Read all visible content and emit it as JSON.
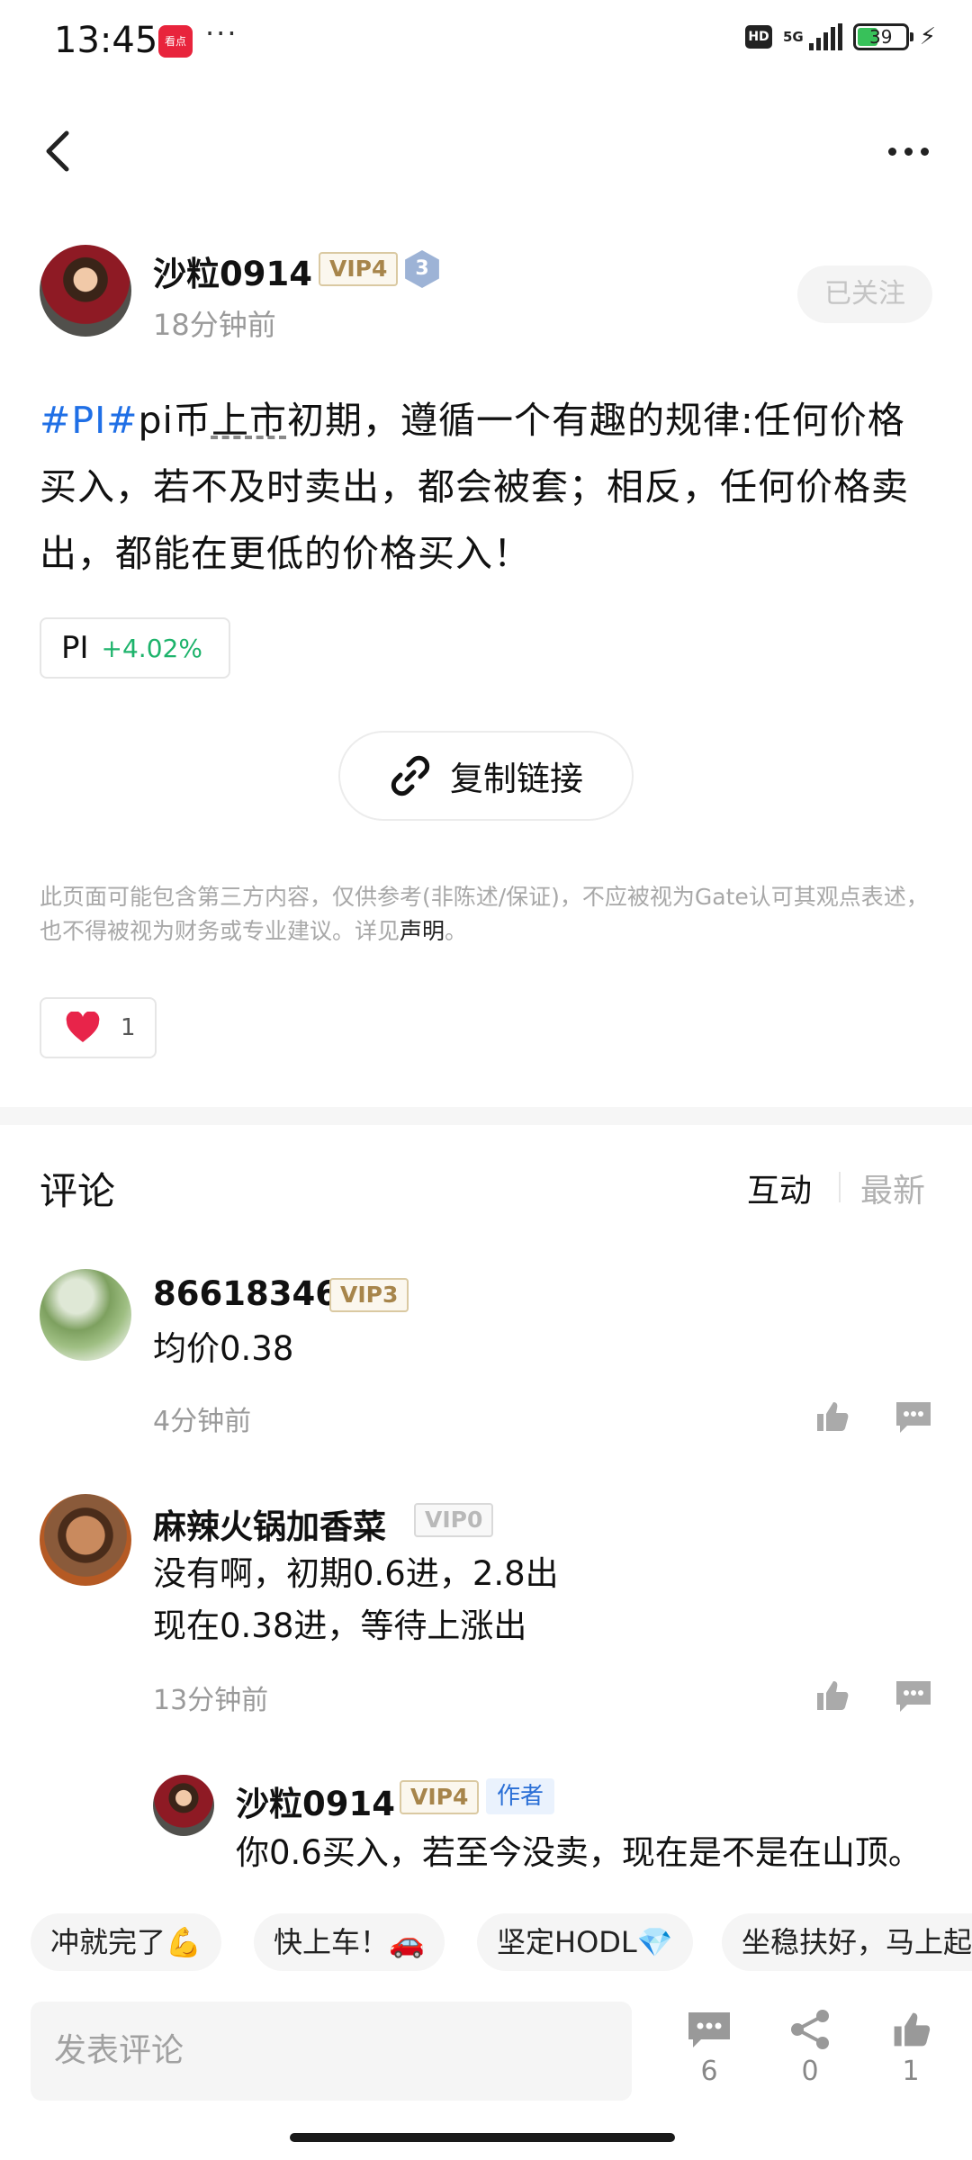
{
  "status_bar": {
    "time": "13:45",
    "app_badge": "看点",
    "more_dots": "···",
    "hd_label": "HD",
    "network_label": "5G",
    "battery_level": "39"
  },
  "nav": {
    "back_icon": "chevron-left-icon",
    "more_icon": "more-horizontal-icon"
  },
  "author": {
    "name": "沙粒0914",
    "vip": "VIP4",
    "level": "3",
    "time": "18分钟前",
    "follow_label": "已关注"
  },
  "post": {
    "hashtag": "#PI#",
    "text_part1": "pi币",
    "text_underlined": "上市",
    "text_part2": "初期，遵循一个有趣的规律:任何价格买入，若不及时卖出，都会被套；相反，任何价格卖出，都能在更低的价格买入！",
    "ticker_symbol": "PI",
    "ticker_change": "+4.02%",
    "ticker_change_color": "#1db36b",
    "copy_link_label": "复制链接",
    "disclaimer_text": "此页面可能包含第三方内容，仅供参考(非陈述/保证)，不应被视为Gate认可其观点表述，也不得被视为财务或专业建议。详见",
    "disclaimer_link": "声明",
    "disclaimer_end": "。",
    "like_count": "1"
  },
  "comments": {
    "title": "评论",
    "sort_active": "互动",
    "sort_inactive": "最新",
    "items": [
      {
        "name": "86618346",
        "vip": "VIP3",
        "text_lines": [
          "均价0.38"
        ],
        "time": "4分钟前"
      },
      {
        "name": "麻辣火锅加香菜",
        "vip": "VIP0",
        "text_lines": [
          "没有啊，初期0.6进，2.8出",
          "现在0.38进，等待上涨出"
        ],
        "time": "13分钟前"
      }
    ],
    "reply": {
      "name": "沙粒0914",
      "vip": "VIP4",
      "author_tag": "作者",
      "text": "你0.6买入，若至今没卖，现在是不是在山顶。"
    }
  },
  "quick_replies": [
    "冲就完了💪",
    "快上车！🚗",
    "坚定HODL💎",
    "坐稳扶好，马上起"
  ],
  "bottom_bar": {
    "input_placeholder": "发表评论",
    "comment_count": "6",
    "share_count": "0",
    "like_count": "1"
  },
  "colors": {
    "accent_blue": "#1f6fe6",
    "vip_gold": "#a7854b",
    "like_red": "#e8244a"
  }
}
